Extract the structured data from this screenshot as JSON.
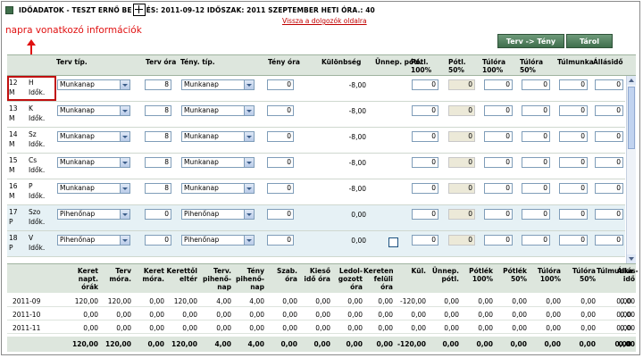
{
  "title": {
    "prefix": "IDŐADATOK - TESZT ERNŐ BE",
    "suffix": "ÉS: 2011-09-12 IDŐSZAK: 2011 SZEPTEMBER HETI ÓRA.: 40"
  },
  "back_link": "Vissza a dolgozók oldalra",
  "annotation": "napra vonatkozó információk",
  "buttons": {
    "plan_to_actual": "Terv -> Tény",
    "save": "Tárol"
  },
  "columns": {
    "plan_type": "Terv típ.",
    "plan_hours": "Terv óra",
    "actual_type": "Tény. típ.",
    "actual_hours": "Tény óra",
    "difference": "Különbség",
    "holiday_extra": "Ünnep. pótl.",
    "extra_100": [
      "Pótl.",
      "100%"
    ],
    "extra_50": [
      "Pótl.",
      "50%"
    ],
    "overtime_100": [
      "Túlóra",
      "100%"
    ],
    "overtime_50": [
      "Túlóra",
      "50%"
    ],
    "overwork": "Túlmunka",
    "standby": "Állásidő"
  },
  "days": [
    {
      "num": "12",
      "dow": "H",
      "line2a": "M",
      "line2b": "Idők.",
      "plan_type": "Munkanap",
      "plan_hours": "8",
      "actual_type": "Munkanap",
      "actual_hours": "0",
      "difference": "-8,00",
      "extra_100": "0",
      "extra_50": "0",
      "ot_100": "0",
      "ot_50": "0",
      "overwork": "0",
      "standby": "0"
    },
    {
      "num": "13",
      "dow": "K",
      "line2a": "M",
      "line2b": "Idők.",
      "plan_type": "Munkanap",
      "plan_hours": "8",
      "actual_type": "Munkanap",
      "actual_hours": "0",
      "difference": "-8,00",
      "extra_100": "0",
      "extra_50": "0",
      "ot_100": "0",
      "ot_50": "0",
      "overwork": "0",
      "standby": "0"
    },
    {
      "num": "14",
      "dow": "Sz",
      "line2a": "M",
      "line2b": "Idők.",
      "plan_type": "Munkanap",
      "plan_hours": "8",
      "actual_type": "Munkanap",
      "actual_hours": "0",
      "difference": "-8,00",
      "extra_100": "0",
      "extra_50": "0",
      "ot_100": "0",
      "ot_50": "0",
      "overwork": "0",
      "standby": "0"
    },
    {
      "num": "15",
      "dow": "Cs",
      "line2a": "M",
      "line2b": "Idők.",
      "plan_type": "Munkanap",
      "plan_hours": "8",
      "actual_type": "Munkanap",
      "actual_hours": "0",
      "difference": "-8,00",
      "extra_100": "0",
      "extra_50": "0",
      "ot_100": "0",
      "ot_50": "0",
      "overwork": "0",
      "standby": "0"
    },
    {
      "num": "16",
      "dow": "P",
      "line2a": "M",
      "line2b": "Idők.",
      "plan_type": "Munkanap",
      "plan_hours": "8",
      "actual_type": "Munkanap",
      "actual_hours": "0",
      "difference": "-8,00",
      "extra_100": "0",
      "extra_50": "0",
      "ot_100": "0",
      "ot_50": "0",
      "overwork": "0",
      "standby": "0"
    },
    {
      "num": "17",
      "dow": "Szo",
      "line2a": "P",
      "line2b": "Idők.",
      "plan_type": "Pihenőnap",
      "plan_hours": "0",
      "actual_type": "Pihenőnap",
      "actual_hours": "0",
      "difference": "0,00",
      "extra_100": "0",
      "extra_50": "0",
      "ot_100": "0",
      "ot_50": "0",
      "overwork": "0",
      "standby": "0"
    },
    {
      "num": "18",
      "dow": "V",
      "line2a": "P",
      "line2b": "Idők.",
      "plan_type": "Pihenőnap",
      "plan_hours": "0",
      "actual_type": "Pihenőnap",
      "actual_hours": "0",
      "difference": "0,00",
      "extra_100": "0",
      "extra_50": "0",
      "ot_100": "0",
      "ot_50": "0",
      "overwork": "0",
      "standby": "0"
    }
  ],
  "summary": {
    "headers": [
      [
        "Keret",
        "napt.",
        "órák"
      ],
      [
        "Terv",
        "móra."
      ],
      [
        "Keret",
        "móra."
      ],
      [
        "Kerettől",
        "eltér"
      ],
      [
        "Terv.",
        "pihenő-",
        "nap"
      ],
      [
        "Tény",
        "pihenő-",
        "nap"
      ],
      [
        "Szab.",
        "óra"
      ],
      [
        "Kieső",
        "idő óra"
      ],
      [
        "Ledol-",
        "gozott",
        "óra"
      ],
      [
        "Kereten",
        "felüli",
        "óra"
      ],
      [
        "Kül."
      ],
      [
        "Ünnep.",
        "pótl."
      ],
      [
        "Pótlék",
        "100%"
      ],
      [
        "Pótlék",
        "50%"
      ],
      [
        "Túlóra",
        "100%"
      ],
      [
        "Túlóra",
        "50%"
      ],
      [
        "Túlmunka"
      ],
      [
        "Állás-",
        "idő"
      ]
    ],
    "rows": [
      {
        "label": "2011-09",
        "values": [
          "120,00",
          "120,00",
          "0,00",
          "120,00",
          "4,00",
          "4,00",
          "0,00",
          "0,00",
          "0,00",
          "0,00",
          "-120,00",
          "0,00",
          "0,00",
          "0,00",
          "0,00",
          "0,00",
          "0,00",
          "0,00"
        ]
      },
      {
        "label": "2011-10",
        "values": [
          "0,00",
          "0,00",
          "0,00",
          "0,00",
          "0,00",
          "0,00",
          "0,00",
          "0,00",
          "0,00",
          "0,00",
          "0,00",
          "0,00",
          "0,00",
          "0,00",
          "0,00",
          "0,00",
          "0,00",
          "0,00"
        ]
      },
      {
        "label": "2011-11",
        "values": [
          "0,00",
          "0,00",
          "0,00",
          "0,00",
          "0,00",
          "0,00",
          "0,00",
          "0,00",
          "0,00",
          "0,00",
          "0,00",
          "0,00",
          "0,00",
          "0,00",
          "0,00",
          "0,00",
          "0,00",
          "0,00"
        ]
      }
    ],
    "totals": [
      "120,00",
      "120,00",
      "0,00",
      "120,00",
      "4,00",
      "4,00",
      "0,00",
      "0,00",
      "0,00",
      "0,00",
      "-120,00",
      "0,00",
      "0,00",
      "0,00",
      "0,00",
      "0,00",
      "0,00",
      "0,00"
    ]
  }
}
